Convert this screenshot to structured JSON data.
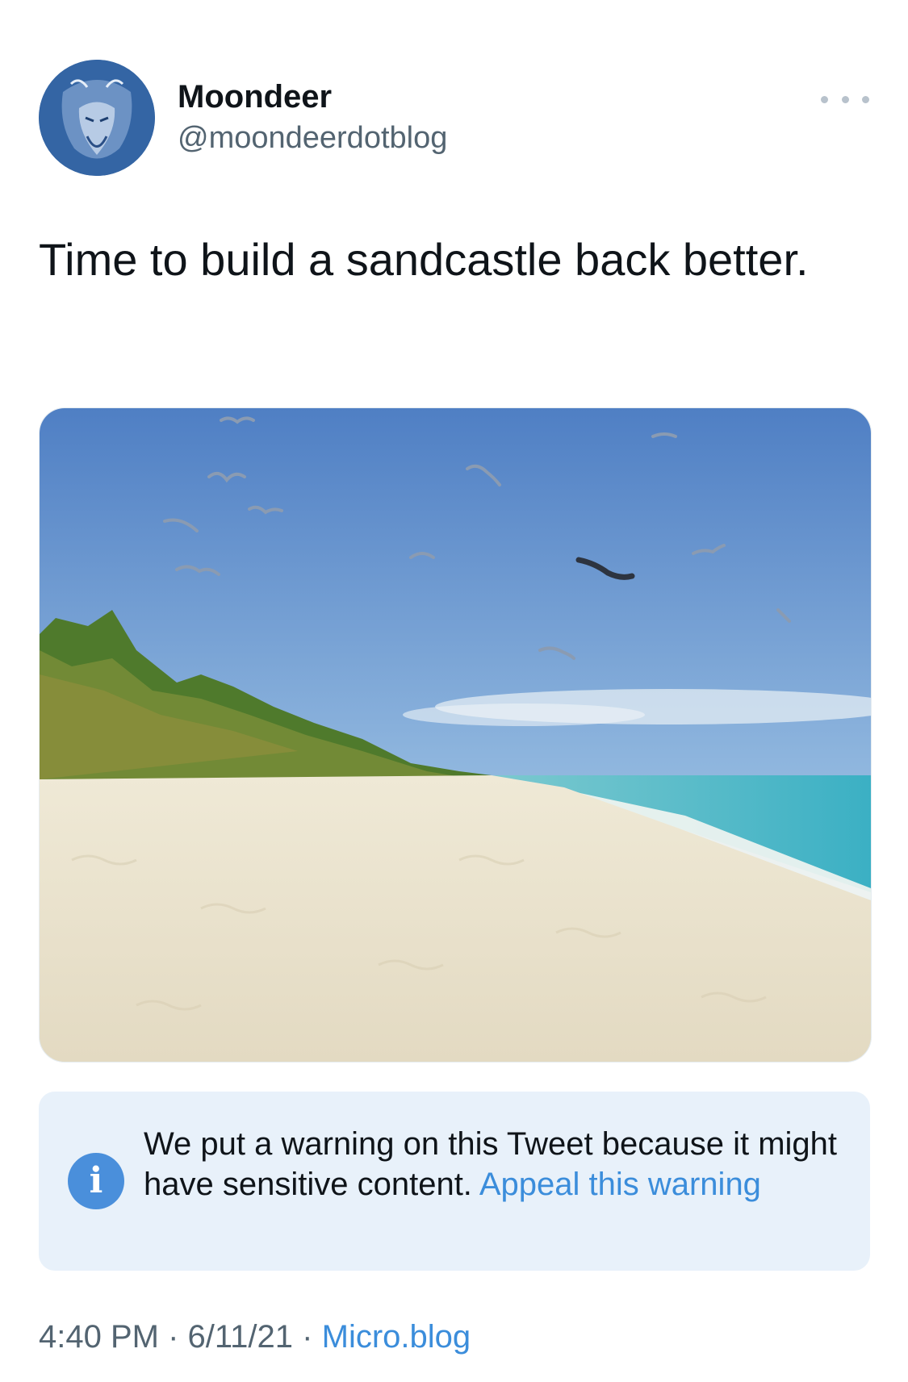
{
  "author": {
    "display_name": "Moondeer",
    "handle": "@moondeerdotblog"
  },
  "tweet": {
    "text": "Time to build a sandcastle back better."
  },
  "warning": {
    "message": "We put a warning on this Tweet because it might have sensitive content.",
    "appeal_label": "Appeal this warning"
  },
  "meta": {
    "time": "4:40 PM",
    "separator": "·",
    "date": "6/11/21",
    "source": "Micro.blog"
  },
  "icons": {
    "more": "more-horizontal-icon",
    "info": "info-icon"
  },
  "colors": {
    "link": "#3b8ddb",
    "warning_bg": "#e8f1fa",
    "secondary_text": "#536471"
  }
}
